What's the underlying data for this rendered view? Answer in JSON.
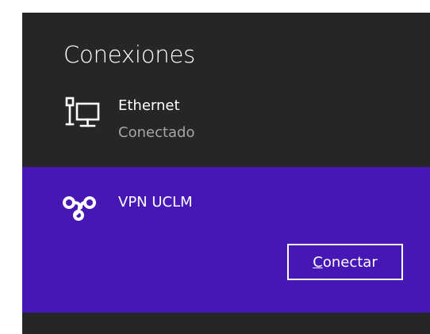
{
  "panel": {
    "title": "Conexiones"
  },
  "networks": {
    "ethernet": {
      "icon": "wired-network-icon",
      "name": "Ethernet",
      "status": "Conectado"
    },
    "vpn": {
      "icon": "vpn-icon",
      "name": "VPN UCLM",
      "button_accel": "C",
      "button_rest": "onectar"
    }
  },
  "colors": {
    "panel_bg": "#262626",
    "selected_bg": "#4617b4",
    "text_primary": "#ffffff",
    "text_secondary": "#a6a6a6"
  }
}
